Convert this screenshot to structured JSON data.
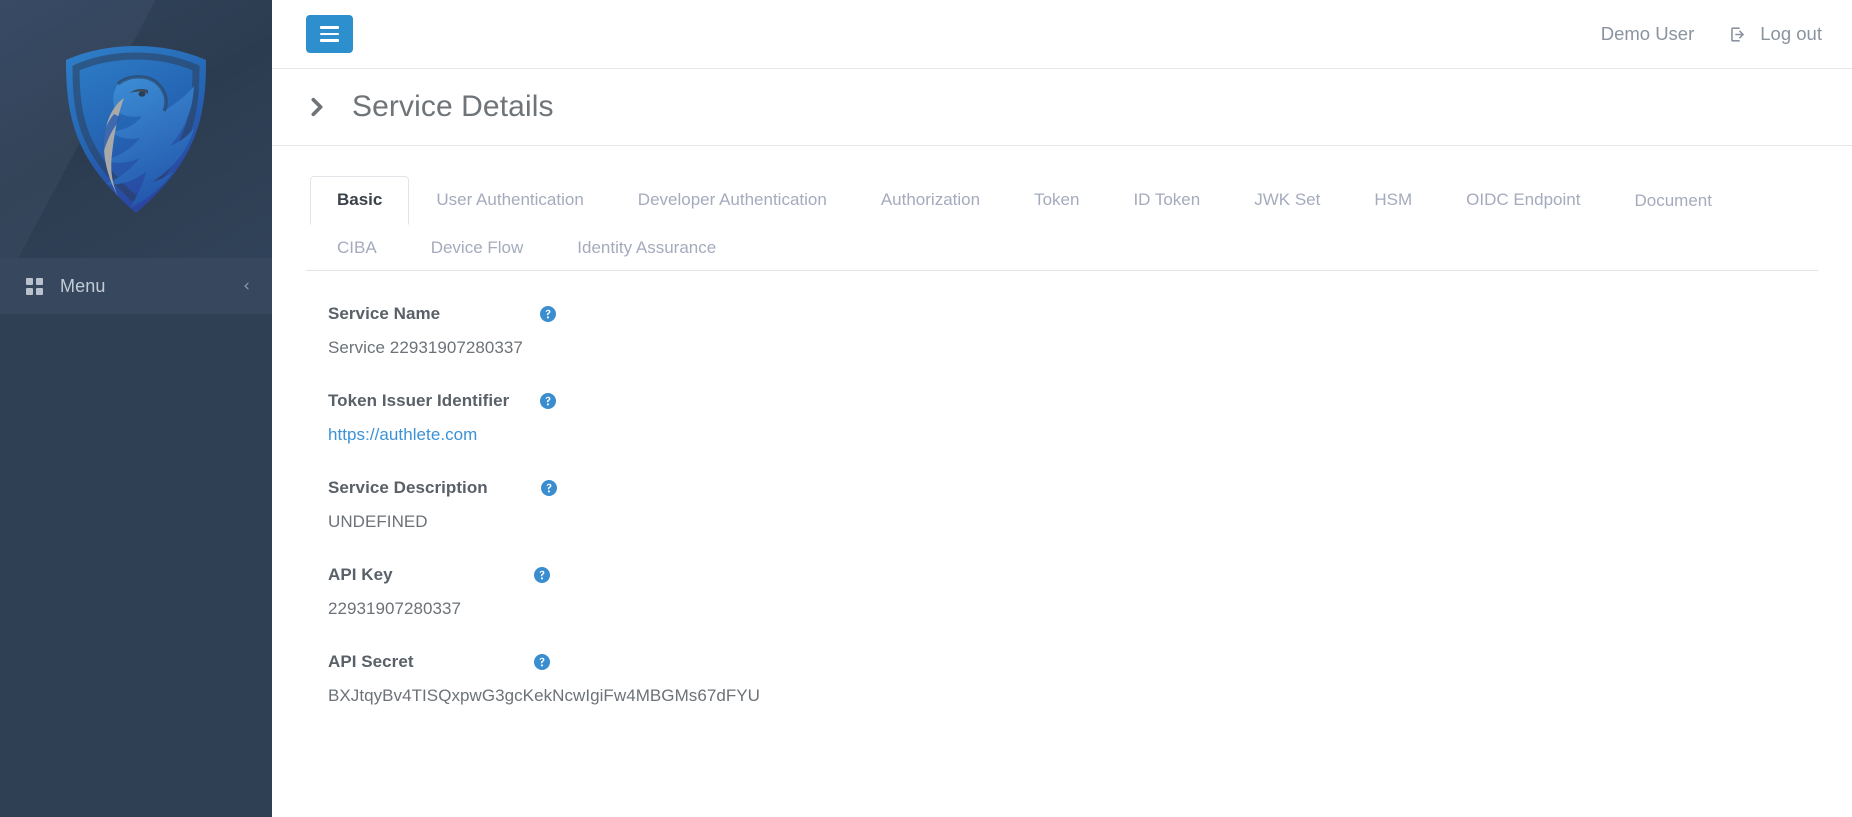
{
  "sidebar": {
    "logo_icon": "authlete-shield-eagle-logo",
    "menu": {
      "icon": "grid-icon",
      "label": "Menu",
      "collapse_icon": "chevron-left-icon"
    }
  },
  "topbar": {
    "menu_toggle_icon": "hamburger-icon",
    "user_name": "Demo User",
    "logout_icon": "sign-out-icon",
    "logout_label": "Log out"
  },
  "page": {
    "chevron_icon": "chevron-right-icon",
    "title": "Service Details"
  },
  "tabs": {
    "active": "Basic",
    "row1": [
      {
        "label": "Basic",
        "active": true
      },
      {
        "label": "User Authentication",
        "active": false
      },
      {
        "label": "Developer Authentication",
        "active": false
      },
      {
        "label": "Authorization",
        "active": false
      },
      {
        "label": "Token",
        "active": false
      },
      {
        "label": "ID Token",
        "active": false
      },
      {
        "label": "JWK Set",
        "active": false
      },
      {
        "label": "HSM",
        "active": false
      },
      {
        "label": "OIDC Endpoint",
        "active": false
      }
    ],
    "row2": [
      {
        "label": "Document",
        "active": false
      },
      {
        "label": "CIBA",
        "active": false
      },
      {
        "label": "Device Flow",
        "active": false
      },
      {
        "label": "Identity Assurance",
        "active": false
      }
    ]
  },
  "fields": [
    {
      "label": "Service Name",
      "value": "Service 22931907280337",
      "help_icon": "help-circle-icon",
      "is_link": false
    },
    {
      "label": "Token Issuer Identifier",
      "value": "https://authlete.com",
      "help_icon": "help-circle-icon",
      "is_link": true
    },
    {
      "label": "Service Description",
      "value": "UNDEFINED",
      "help_icon": "help-circle-icon",
      "is_link": false
    },
    {
      "label": "API Key",
      "value": "22931907280337",
      "help_icon": "help-circle-icon",
      "is_link": false
    },
    {
      "label": "API Secret",
      "value": "BXJtqyBv4TISQxpwG3gcKekNcwIgiFw4MBGMs67dFYU",
      "help_icon": "help-circle-icon",
      "is_link": false
    }
  ],
  "colors": {
    "accent_blue": "#2d8fcd",
    "link_blue": "#3a93d8",
    "sidebar_bg": "#2f4055",
    "sidebar_menu_bg": "#37485e",
    "help_icon_blue": "#3a8ed0"
  }
}
